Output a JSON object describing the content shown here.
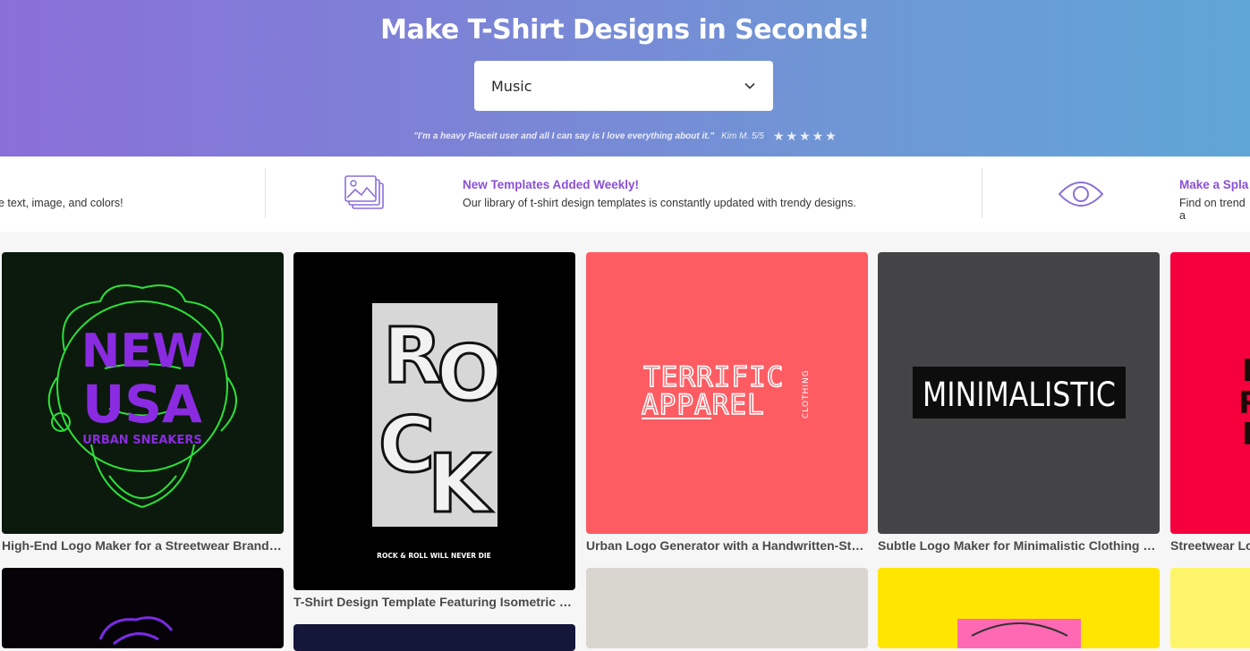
{
  "hero": {
    "title": "Make T-Shirt Designs in Seconds!",
    "category_select": {
      "value": "Music"
    },
    "review": {
      "quote": "\"I'm a heavy Placeit user and all I can say is I love everything about it.\"",
      "author": "Kim M. 5/5",
      "rating": 5
    }
  },
  "features": {
    "left_partial_desc": "e text, image, and colors!",
    "weekly": {
      "title": "New Templates Added Weekly!",
      "desc": "Our library of t-shirt design templates is constantly updated with trendy designs."
    },
    "right_partial": {
      "title": "Make a Spla",
      "desc": "Find on trend a"
    }
  },
  "colors": {
    "accent": "#8a4fd6",
    "hero_start": "#8a6fd9",
    "hero_end": "#5fa6d6"
  },
  "templates": [
    {
      "caption": "High-End Logo Maker for a Streetwear Brand Featuring a Medusa Graphic",
      "art_top": "NEW",
      "art_mid": "USA",
      "art_bottom": "URBAN SNEAKERS",
      "bg": "#0b1a0c"
    },
    {
      "caption": "T-Shirt Design Template Featuring Isometric Letters",
      "art_word": "ROCK",
      "art_tag": "ROCK & ROLL WILL NEVER DIE",
      "bg": "#000000"
    },
    {
      "caption": "Urban Logo Generator with a Handwritten-Style Font",
      "art_line1": "TERRIFIC",
      "art_line2": "APPAREL",
      "art_side": "CLOTHING",
      "bg": "#fd5c63"
    },
    {
      "caption": "Subtle Logo Maker for Minimalistic Clothing Brands",
      "art_word": "MINIMALISTIC",
      "bg": "#444447"
    },
    {
      "caption": "Streetwear Logo",
      "bg": "#f5003c"
    }
  ]
}
